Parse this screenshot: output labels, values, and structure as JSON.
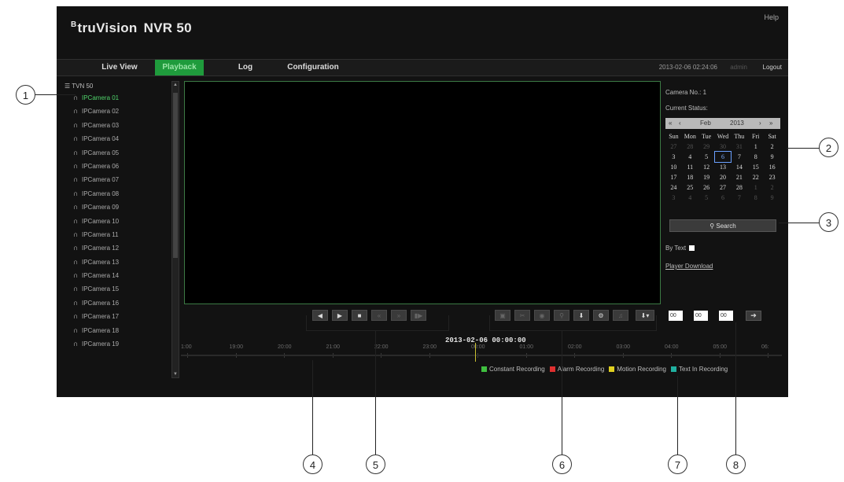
{
  "header": {
    "brand": "truVision",
    "brand_mark": "B",
    "product": "NVR 50",
    "help": "Help"
  },
  "nav": {
    "tabs": [
      {
        "label": "Live View",
        "active": false
      },
      {
        "label": "Playback",
        "active": true
      },
      {
        "label": "Log",
        "active": false
      },
      {
        "label": "Configuration",
        "active": false
      }
    ],
    "datetime": "2013-02-06 02:24:06",
    "user": "admin",
    "logout": "Logout"
  },
  "camera_tree": {
    "root": "TVN 50",
    "cameras": [
      "IPCamera 01",
      "IPCamera 02",
      "IPCamera 03",
      "IPCamera 04",
      "IPCamera 05",
      "IPCamera 06",
      "IPCamera 07",
      "IPCamera 08",
      "IPCamera 09",
      "IPCamera 10",
      "IPCamera 11",
      "IPCamera 12",
      "IPCamera 13",
      "IPCamera 14",
      "IPCamera 15",
      "IPCamera 16",
      "IPCamera 17",
      "IPCamera 18",
      "IPCamera 19"
    ],
    "selected": "IPCamera 01"
  },
  "right_panel": {
    "camera_no": "Camera No.: 1",
    "current_status": "Current Status:",
    "calendar": {
      "month": "Feb",
      "year": "2013",
      "weekdays": [
        "Sun",
        "Mon",
        "Tue",
        "Wed",
        "Thu",
        "Fri",
        "Sat"
      ],
      "rows": [
        [
          "27",
          "28",
          "29",
          "30",
          "31",
          "1",
          "2"
        ],
        [
          "3",
          "4",
          "5",
          "6",
          "7",
          "8",
          "9"
        ],
        [
          "10",
          "11",
          "12",
          "13",
          "14",
          "15",
          "16"
        ],
        [
          "17",
          "18",
          "19",
          "20",
          "21",
          "22",
          "23"
        ],
        [
          "24",
          "25",
          "26",
          "27",
          "28",
          "1",
          "2"
        ],
        [
          "3",
          "4",
          "5",
          "6",
          "7",
          "8",
          "9"
        ]
      ],
      "selected_day": "6"
    },
    "search": "Search",
    "by_text": "By Text",
    "player_download": "Player Download",
    "time": {
      "hh": "00",
      "mm": "00",
      "ss": "00"
    }
  },
  "timeline": {
    "date": "2013-02-06 00:00:00",
    "labels": [
      "1:00",
      "19:00",
      "20:00",
      "21:00",
      "22:00",
      "23:00",
      "00:00",
      "01:00",
      "02:00",
      "03:00",
      "04:00",
      "05:00",
      "06:"
    ]
  },
  "legend": [
    {
      "label": "Constant Recording",
      "color": "#3fbf3f"
    },
    {
      "label": "Alarm Recording",
      "color": "#e03030"
    },
    {
      "label": "Motion Recording",
      "color": "#e0d020"
    },
    {
      "label": "Text In Recording",
      "color": "#20b0a0"
    }
  ],
  "callouts": [
    "1",
    "2",
    "3",
    "4",
    "5",
    "6",
    "7",
    "8"
  ],
  "colors": {
    "accent": "#1f9b3c",
    "selected_text": "#4fd26a",
    "background": "#121212"
  }
}
